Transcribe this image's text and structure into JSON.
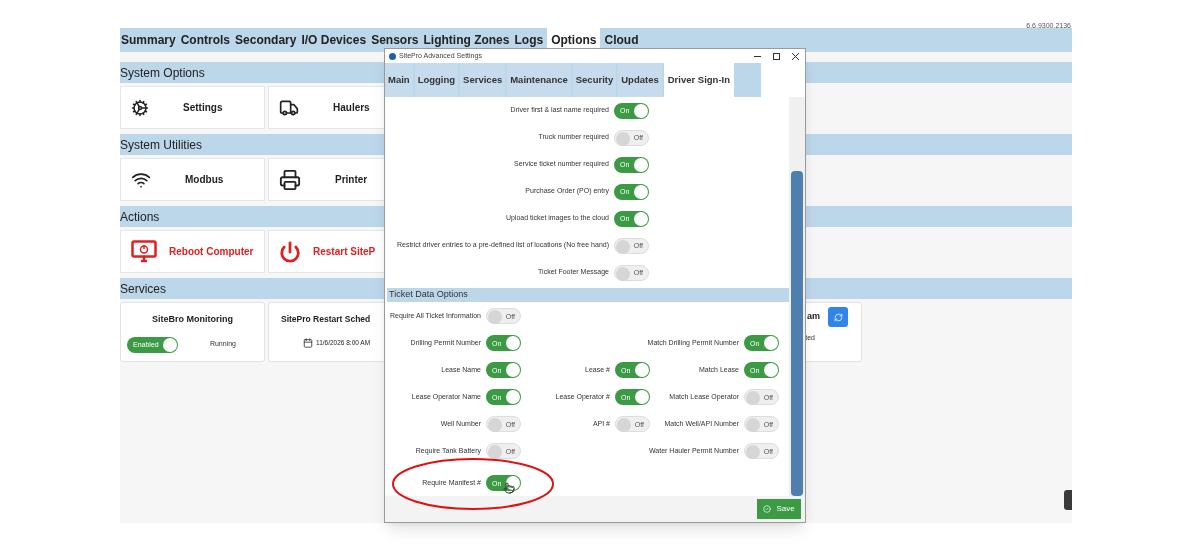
{
  "app": {
    "version": "6.6.9300.2136",
    "tabs": [
      {
        "label": "Summary",
        "selected": false
      },
      {
        "label": "Controls",
        "selected": false
      },
      {
        "label": "Secondary",
        "selected": false
      },
      {
        "label": "I/O Devices",
        "selected": false
      },
      {
        "label": "Sensors",
        "selected": false
      },
      {
        "label": "Lighting Zones",
        "selected": false
      },
      {
        "label": "Logs",
        "selected": false
      },
      {
        "label": "Options",
        "selected": true
      },
      {
        "label": "Cloud",
        "selected": false
      }
    ],
    "sections": [
      {
        "title": "System Options",
        "cards": [
          {
            "label": "Settings",
            "kind": "normal"
          },
          {
            "label": "Haulers",
            "kind": "normal"
          }
        ]
      },
      {
        "title": "System Utilities",
        "cards": [
          {
            "label": "Modbus",
            "kind": "normal"
          },
          {
            "label": "Printer",
            "kind": "normal"
          }
        ]
      },
      {
        "title": "Actions",
        "cards": [
          {
            "label": "Reboot Computer",
            "kind": "danger"
          },
          {
            "label": "Restart SiteP",
            "kind": "danger"
          }
        ]
      },
      {
        "title": "Services",
        "service_cards": [
          {
            "kind": "toggle",
            "title": "SiteBro Monitoring",
            "switch": {
              "text": "Enabled",
              "on": true
            },
            "status": "Running"
          },
          {
            "kind": "schedule",
            "title": "SitePro Restart Sched",
            "date": "11/6/2026 8:00 AM"
          },
          {
            "kind": "refresh",
            "title": "am",
            "status": "ted"
          }
        ]
      }
    ]
  },
  "dialog": {
    "title": "SitePro Advanced Settings",
    "tabs": [
      {
        "label": "Main",
        "selected": false
      },
      {
        "label": "Logging",
        "selected": false
      },
      {
        "label": "Services",
        "selected": false
      },
      {
        "label": "Maintenance",
        "selected": false
      },
      {
        "label": "Security",
        "selected": false
      },
      {
        "label": "Updates",
        "selected": false
      },
      {
        "label": "Driver Sign-In",
        "selected": true
      }
    ],
    "options": [
      {
        "label": "Driver first & last name required",
        "on": true,
        "switch_text": "On"
      },
      {
        "label": "Truck number required",
        "on": false,
        "switch_text": "Off"
      },
      {
        "label": "Service ticket number required",
        "on": true,
        "switch_text": "On"
      },
      {
        "label": "Purchase Order (PO) entry",
        "on": true,
        "switch_text": "On"
      },
      {
        "label": "Upload ticket images to the cloud",
        "on": true,
        "switch_text": "On"
      },
      {
        "label": "Restrict driver entries to a pre-defined list of locations (No free hand)",
        "on": false,
        "switch_text": "Off"
      },
      {
        "label": "Ticket Footer Message",
        "on": false,
        "switch_text": "Off"
      }
    ],
    "ticket_section": {
      "title": "Ticket Data Options",
      "rows": [
        {
          "left": {
            "label": "Require All Ticket Information",
            "on": false,
            "switch_text": "Off"
          }
        },
        {
          "left": {
            "label": "Drilling Permit Number",
            "on": true,
            "switch_text": "On"
          },
          "right": {
            "label": "Match Drilling Permit Number",
            "on": true,
            "switch_text": "On"
          }
        },
        {
          "left": {
            "label": "Lease Name",
            "on": true,
            "switch_text": "On"
          },
          "middle": {
            "label": "Lease #",
            "on": true,
            "switch_text": "On"
          },
          "right": {
            "label": "Match Lease",
            "on": true,
            "switch_text": "On"
          }
        },
        {
          "left": {
            "label": "Lease Operator Name",
            "on": true,
            "switch_text": "On"
          },
          "middle": {
            "label": "Lease Operator #",
            "on": true,
            "switch_text": "On"
          },
          "right": {
            "label": "Match Lease Operator",
            "on": false,
            "switch_text": "Off"
          }
        },
        {
          "left": {
            "label": "Well Number",
            "on": false,
            "switch_text": "Off"
          },
          "middle": {
            "label": "API #",
            "on": false,
            "switch_text": "Off"
          },
          "right": {
            "label": "Match Well/API Number",
            "on": false,
            "switch_text": "Off"
          }
        },
        {
          "left": {
            "label": "Require Tank Battery",
            "on": false,
            "switch_text": "Off"
          },
          "right": {
            "label": "Water Hauler Permit Number",
            "on": false,
            "switch_text": "Off"
          }
        },
        {
          "left": {
            "label": "Require Manifest #",
            "on": true,
            "switch_text": "On"
          }
        }
      ]
    },
    "save_label": "Save"
  }
}
